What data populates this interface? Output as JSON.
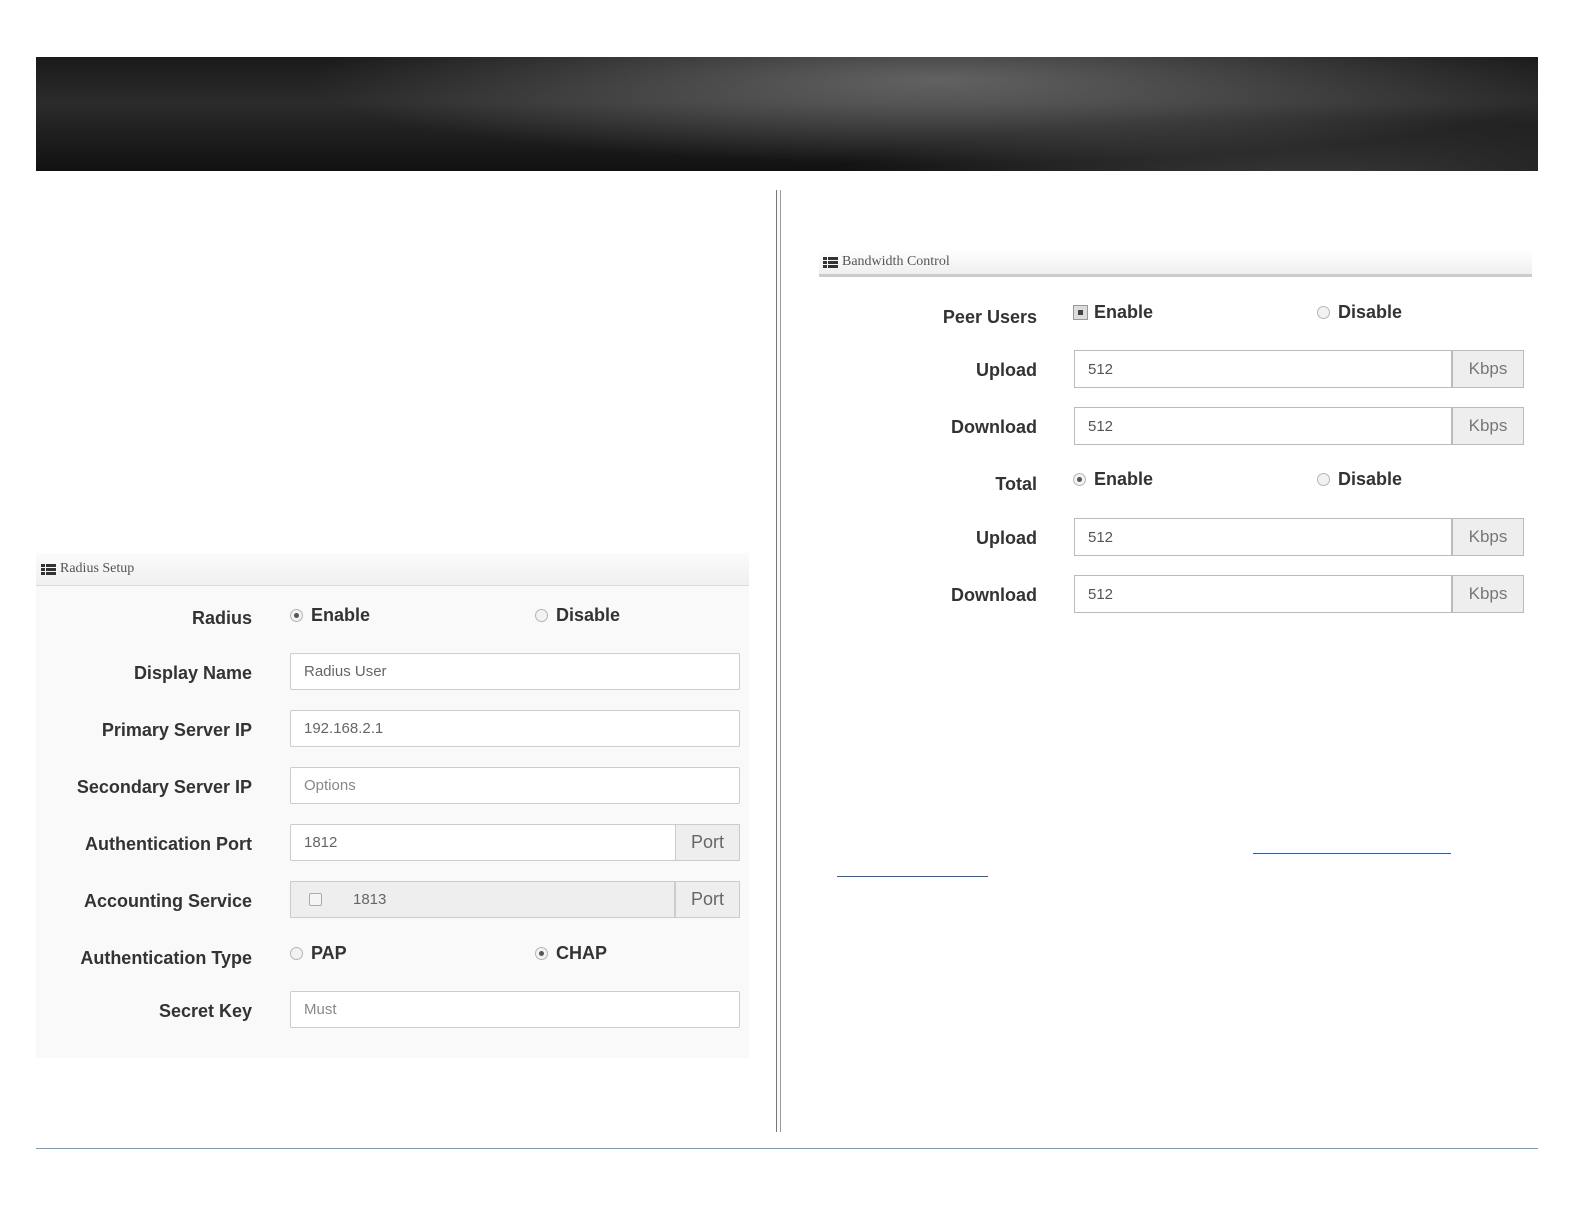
{
  "radius_setup": {
    "title": "Radius Setup",
    "radius": {
      "label": "Radius",
      "enable": "Enable",
      "disable": "Disable",
      "selected": "Enable"
    },
    "display_name": {
      "label": "Display Name",
      "value": "Radius User"
    },
    "primary_server_ip": {
      "label": "Primary Server IP",
      "value": "192.168.2.1"
    },
    "secondary_server_ip": {
      "label": "Secondary Server IP",
      "placeholder": "Options"
    },
    "authentication_port": {
      "label": "Authentication Port",
      "value": "1812",
      "addon": "Port"
    },
    "accounting_service": {
      "label": "Accounting Service",
      "value": "1813",
      "addon": "Port",
      "checked": false
    },
    "authentication_type": {
      "label": "Authentication Type",
      "pap": "PAP",
      "chap": "CHAP",
      "selected": "CHAP"
    },
    "secret_key": {
      "label": "Secret Key",
      "placeholder": "Must"
    }
  },
  "bandwidth_control": {
    "title": "Bandwidth Control",
    "peer_users": {
      "label": "Peer Users",
      "enable": "Enable",
      "disable": "Disable",
      "selected": "Enable"
    },
    "peer_upload": {
      "label": "Upload",
      "value": "512",
      "unit": "Kbps"
    },
    "peer_download": {
      "label": "Download",
      "value": "512",
      "unit": "Kbps"
    },
    "total": {
      "label": "Total",
      "enable": "Enable",
      "disable": "Disable",
      "selected": "Enable"
    },
    "total_upload": {
      "label": "Upload",
      "value": "512",
      "unit": "Kbps"
    },
    "total_download": {
      "label": "Download",
      "value": "512",
      "unit": "Kbps"
    }
  }
}
